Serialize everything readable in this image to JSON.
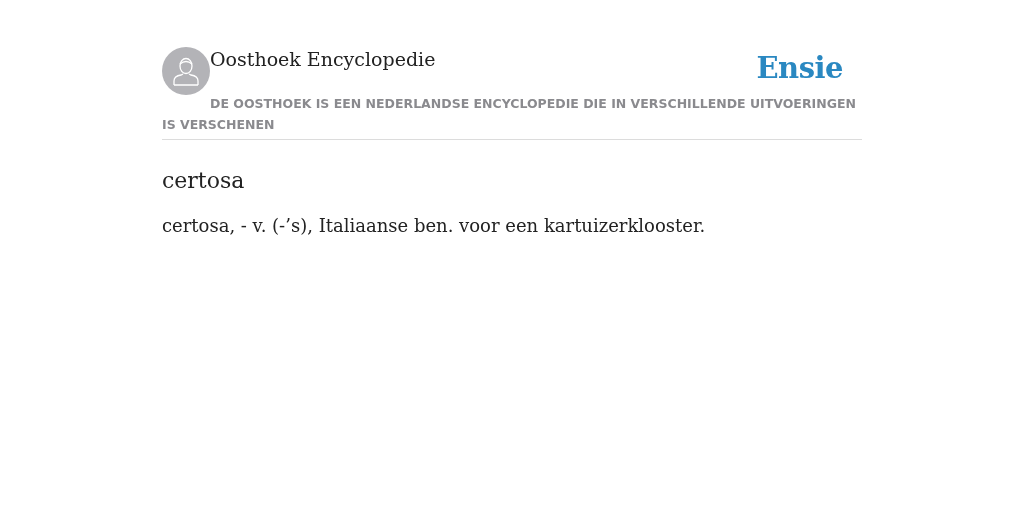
{
  "header": {
    "site_name": "Oosthoek Encyclopedie",
    "logo": "Ensie",
    "description": "DE OOSTHOEK IS EEN NEDERLANDSE ENCYCLOPEDIE DIE IN VERSCHILLENDE UITVOERINGEN IS VERSCHENEN"
  },
  "article": {
    "title": "certosa",
    "body": "certosa, - v. (-’s), Italiaanse ben. voor een kartuizerklooster."
  }
}
